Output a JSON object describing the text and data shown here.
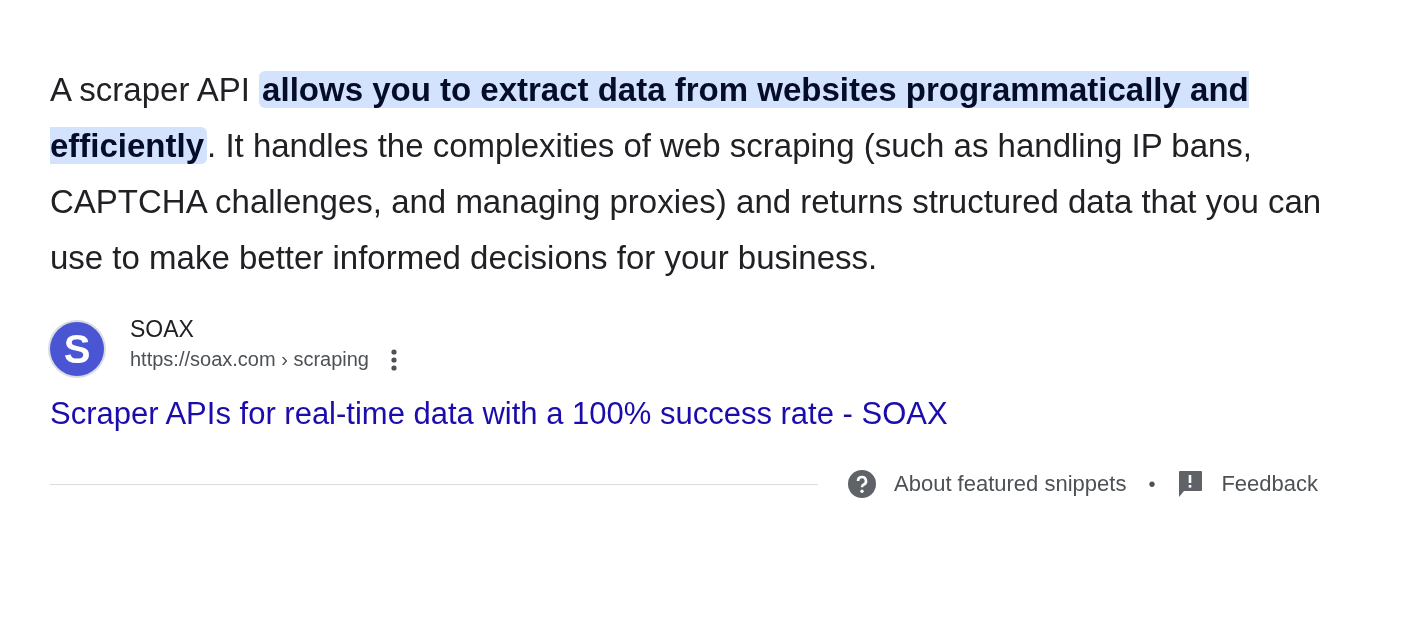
{
  "snippet": [
    {
      "text": "A scraper API ",
      "highlighted": false
    },
    {
      "text": "allows you to extract data from websites programmatically and efficiently",
      "highlighted": true
    },
    {
      "text": ". It handles the complexities of web scraping (such as handling IP bans, CAPTCHA challenges, and managing proxies) and returns structured data that you can use to make better informed decisions for your business.",
      "highlighted": false
    }
  ],
  "source": {
    "name": "SOAX",
    "url": "https://soax.com › scraping",
    "favicon_letter": "S"
  },
  "result_title": "Scraper APIs for real-time data with a 100% success rate - SOAX",
  "footer": {
    "about": "About featured snippets",
    "separator": "•",
    "feedback": "Feedback"
  }
}
